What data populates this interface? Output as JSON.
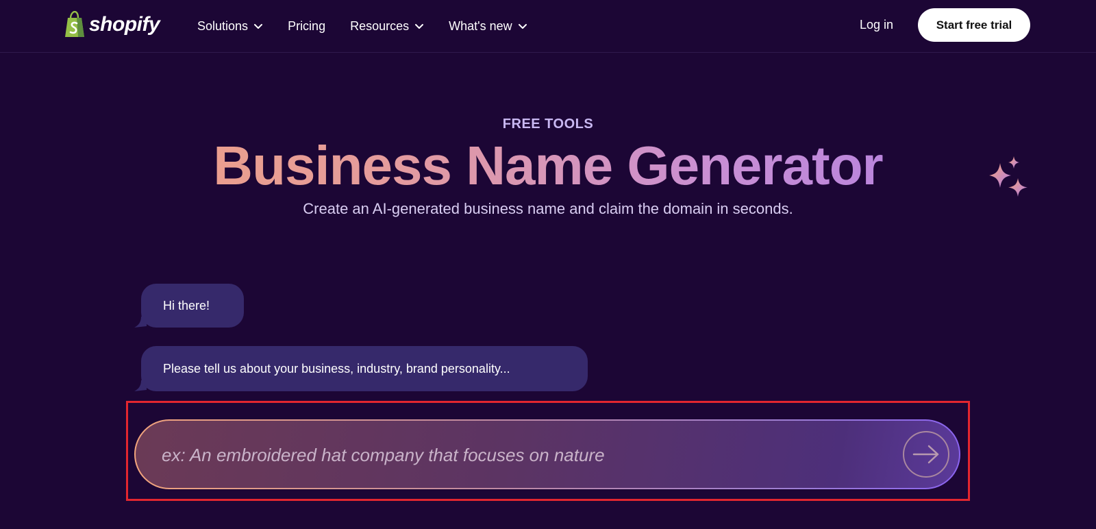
{
  "brand": {
    "name": "shopify",
    "logo_icon": "shopify-bag-icon",
    "logo_color": "#95bf47"
  },
  "nav": {
    "items": [
      {
        "label": "Solutions",
        "has_dropdown": true
      },
      {
        "label": "Pricing",
        "has_dropdown": false
      },
      {
        "label": "Resources",
        "has_dropdown": true
      },
      {
        "label": "What's new",
        "has_dropdown": true
      }
    ],
    "login_label": "Log in",
    "cta_label": "Start free trial"
  },
  "hero": {
    "eyebrow": "FREE TOOLS",
    "title": "Business Name Generator",
    "subtitle": "Create an AI-generated business name and claim the domain in seconds.",
    "decoration_icon": "sparkles-icon"
  },
  "chat": {
    "messages": [
      {
        "text": "Hi there!"
      },
      {
        "text": "Please tell us about your business, industry, brand personality..."
      }
    ],
    "input": {
      "value": "",
      "placeholder": "ex: An embroidered hat company that focuses on nature"
    },
    "send_icon": "arrow-right-icon"
  },
  "colors": {
    "background": "#1c0635",
    "bubble": "#36296b",
    "highlight": "#e3262f",
    "title_gradient_start": "#f0a27e",
    "title_gradient_end": "#a879e6"
  }
}
